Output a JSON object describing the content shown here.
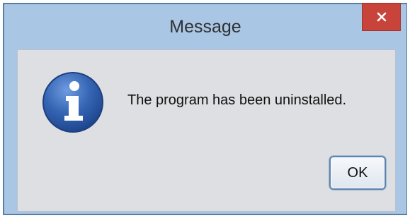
{
  "window": {
    "title": "Message"
  },
  "titlebar_buttons": {
    "close": "close-icon"
  },
  "dialog": {
    "icon": "info-icon",
    "message": "The program has been uninstalled.",
    "ok_label": "OK"
  },
  "colors": {
    "titlebar": "#a9c7e5",
    "close_button": "#c8443b",
    "content_background": "#dedfe2",
    "icon_blue": "#2f5ea8",
    "button_border": "#5f84ad"
  }
}
